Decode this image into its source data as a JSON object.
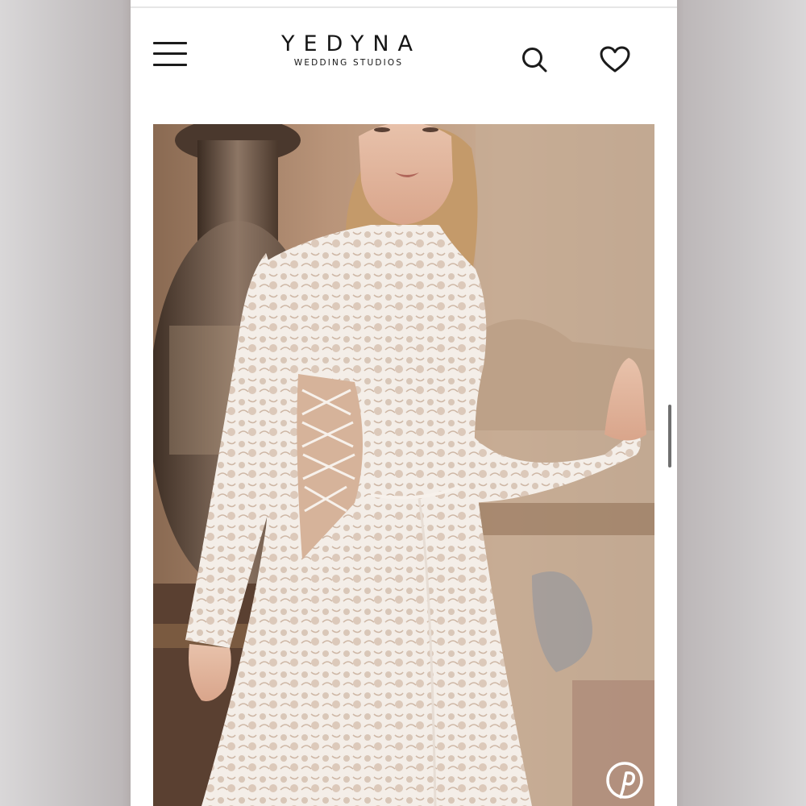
{
  "header": {
    "brand": "YEDYNA",
    "brand_tagline": "WEDDING STUDIOS",
    "menu_icon": "hamburger-menu-icon",
    "search_icon": "search-icon",
    "wishlist_icon": "heart-icon"
  },
  "gallery": {
    "image_alt": "Bride in long-sleeve white lace gown with side lace-up cutouts",
    "share_icon": "pinterest-icon"
  },
  "colors": {
    "text": "#161616",
    "background": "#ffffff"
  }
}
